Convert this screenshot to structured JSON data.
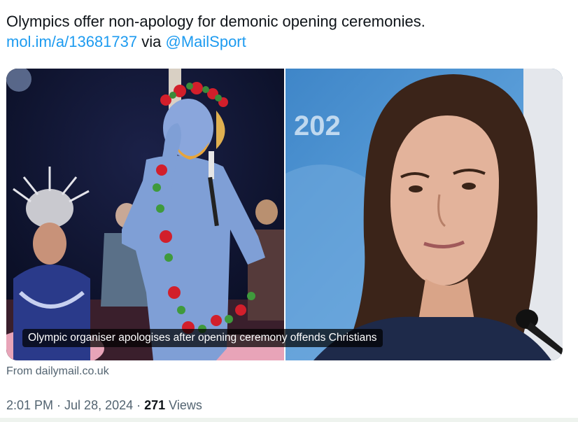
{
  "tweet": {
    "text_line1": "Olympics offer non-apology for demonic opening ceremonies.",
    "link_text": "mol.im/a/13681737",
    "via_text": " via ",
    "mention": "@MailSport"
  },
  "card": {
    "caption": "Olympic organiser apologises after opening ceremony offends Christians",
    "image_right_text": "202",
    "source_label": "From dailymail.co.uk"
  },
  "meta": {
    "time": "2:01 PM",
    "sep1": " · ",
    "date": "Jul 28, 2024",
    "sep2": " · ",
    "views_count": "271",
    "views_label": " Views"
  },
  "colors": {
    "link": "#1d9bf0",
    "text": "#0f1419",
    "secondary": "#536471"
  }
}
